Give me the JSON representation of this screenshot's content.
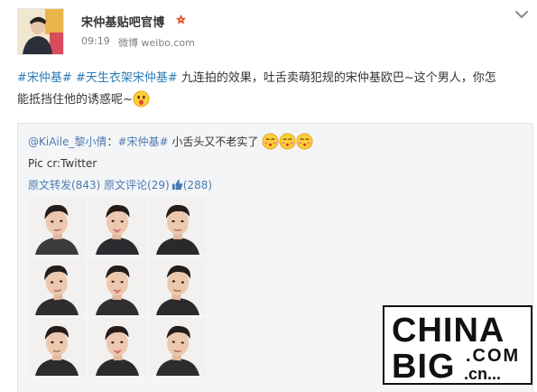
{
  "author": {
    "name": "宋仲基贴吧官博",
    "verified_icon": "red-star-icon",
    "time": "09:19",
    "source": "微博 weibo.com"
  },
  "post": {
    "topic_1": "#宋仲基#",
    "topic_2": "#天生衣架宋仲基#",
    "text_line1": "九连拍的效果，吐舌卖萌犯规的宋仲基欧巴~这个男人，你怎",
    "text_line2": "能抵挡住他的诱惑呢~",
    "emoji": "surprised-face-icon"
  },
  "repost": {
    "user": "@KiAile_黎小倩",
    "separator": "：",
    "topic": "#宋仲基#",
    "text": " 小舌头又不老实了",
    "emojis": [
      "blushing-face-icon",
      "blushing-face-icon",
      "blushing-face-icon"
    ],
    "credit": "Pic cr:Twitter",
    "reposts_label": "原文转发(843)",
    "comments_label": "原文评论(29)",
    "likes_label": "(288)"
  },
  "photos": {
    "count": 9,
    "shirt_colors": [
      "#3b3a3d",
      "#2b2a2e",
      "#2a2a2c",
      "#2e2d30",
      "#2f2e31",
      "#2a292c",
      "#2c2b2e",
      "#2b2a2d",
      "#2d2c2f"
    ]
  },
  "watermark": {
    "line1": "CHINA",
    "line2": "BIG",
    "suffix_top": ".COM",
    "suffix_bottom": ".cn..."
  },
  "colors": {
    "link": "#2b7bb5",
    "repost_link": "#4c7bb2",
    "meta": "#808080",
    "repost_bg": "#f4f5f7"
  }
}
